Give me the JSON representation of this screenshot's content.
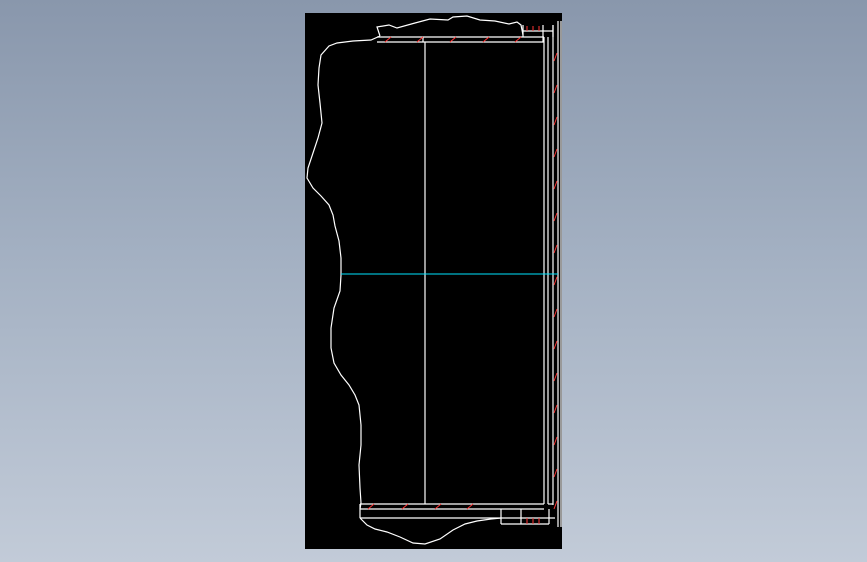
{
  "window": {
    "background": "#8f9db1"
  },
  "drawing": {
    "background": "#000000",
    "colors": {
      "outline": "#ffffff",
      "hatch": "#ff3333",
      "centerline": "#00e5ff"
    }
  }
}
